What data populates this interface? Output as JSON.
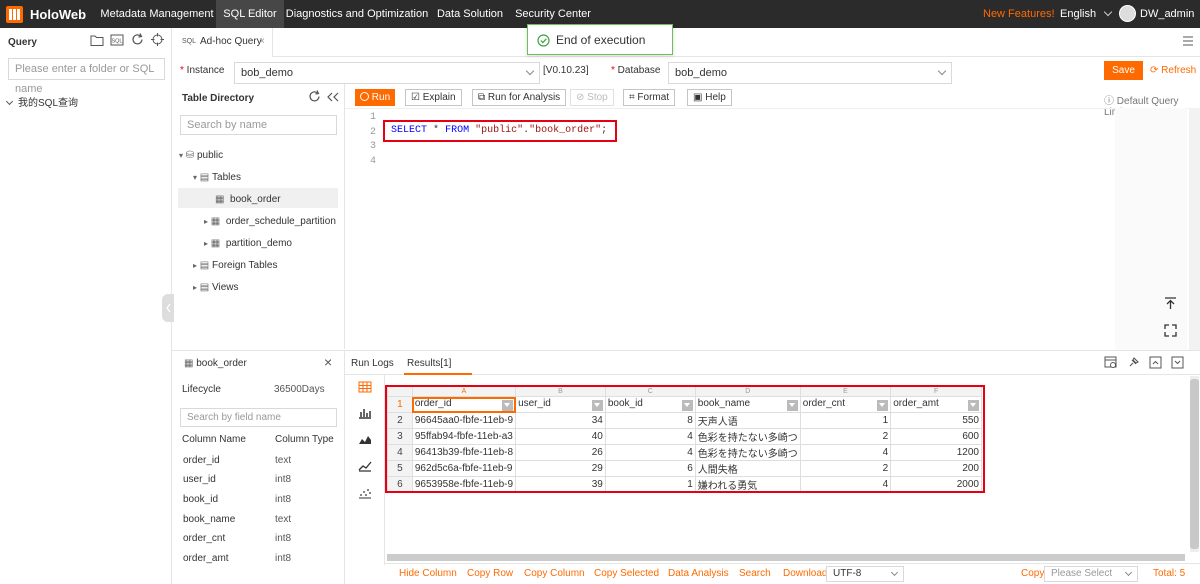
{
  "nav": {
    "brand": "HoloWeb",
    "items": [
      {
        "label": "Metadata Management",
        "active": false
      },
      {
        "label": "SQL Editor",
        "active": true
      },
      {
        "label": "Diagnostics and Optimization",
        "active": false
      },
      {
        "label": "Data Solution",
        "active": false
      },
      {
        "label": "Security Center",
        "active": false
      }
    ],
    "new_features": "New Features!",
    "language": "English",
    "username": "DW_admin"
  },
  "left_panel": {
    "title": "Query",
    "search_placeholder": "Please enter a folder or SQL name",
    "folder_label": "我的SQL查询"
  },
  "toast": {
    "message": "End of execution"
  },
  "tab": {
    "icon_text": "SQL",
    "label": "Ad-hoc Query"
  },
  "instance_bar": {
    "instance_label": "Instance",
    "instance_value": "bob_demo",
    "version": "[V0.10.23]",
    "database_label": "Database",
    "database_value": "bob_demo",
    "save_label": "Save",
    "refresh_label": "Refresh"
  },
  "table_directory": {
    "title": "Table Directory",
    "search_placeholder": "Search by name",
    "schema": "public",
    "tables_label": "Tables",
    "tables": [
      "book_order",
      "order_schedule_partition",
      "partition_demo"
    ],
    "foreign_tables_label": "Foreign Tables",
    "views_label": "Views"
  },
  "toolbar": {
    "run": "Run",
    "explain": "Explain",
    "run_for_analysis": "Run for Analysis",
    "stop": "Stop",
    "format": "Format",
    "help": "Help",
    "default_query_limit": "Default Query Limit"
  },
  "editor": {
    "line_numbers": [
      "1",
      "2",
      "3",
      "4"
    ],
    "sql_tokens": [
      {
        "text": "SELECT",
        "kind": "kw"
      },
      {
        "text": "*",
        "kind": "op"
      },
      {
        "text": "FROM",
        "kind": "kw"
      },
      {
        "text": "\"public\"",
        "kind": "str"
      },
      {
        "text": ".",
        "kind": "plain"
      },
      {
        "text": "\"book_order\"",
        "kind": "str"
      },
      {
        "text": ";",
        "kind": "plain"
      }
    ],
    "colors": {
      "kw": "#0000ff",
      "str": "#a31515",
      "plain": "#333333",
      "op": "#333333"
    }
  },
  "table_info": {
    "table_name": "book_order",
    "lifecycle_label": "Lifecycle",
    "lifecycle_value": "36500Days",
    "field_search_placeholder": "Search by field name",
    "column_name_header": "Column Name",
    "column_type_header": "Column Type",
    "columns": [
      {
        "name": "order_id",
        "type": "text"
      },
      {
        "name": "user_id",
        "type": "int8"
      },
      {
        "name": "book_id",
        "type": "int8"
      },
      {
        "name": "book_name",
        "type": "text"
      },
      {
        "name": "order_cnt",
        "type": "int8"
      },
      {
        "name": "order_amt",
        "type": "int8"
      }
    ]
  },
  "results": {
    "tab_run_logs": "Run Logs",
    "tab_results": "Results[1]",
    "col_letters": [
      "A",
      "B",
      "C",
      "D",
      "E",
      "F"
    ],
    "headers": [
      "order_id",
      "user_id",
      "book_id",
      "book_name",
      "order_cnt",
      "order_amt"
    ],
    "row_numbers": [
      "1",
      "2",
      "3",
      "4",
      "5",
      "6"
    ],
    "rows": [
      [
        "96645aa0-fbfe-11eb-9",
        "34",
        "8",
        "天声人语",
        "1",
        "550"
      ],
      [
        "95ffab94-fbfe-11eb-a3",
        "40",
        "4",
        "色彩を持たない多崎つ",
        "2",
        "600"
      ],
      [
        "96413b39-fbfe-11eb-8",
        "26",
        "4",
        "色彩を持たない多崎つ",
        "4",
        "1200"
      ],
      [
        "962d5c6a-fbfe-11eb-9",
        "29",
        "6",
        "人間失格",
        "2",
        "200"
      ],
      [
        "9653958e-fbfe-11eb-9",
        "39",
        "1",
        "嫌われる勇気",
        "4",
        "2000"
      ]
    ]
  },
  "bottom_bar": {
    "hide_column": "Hide Column",
    "copy_row": "Copy Row",
    "copy_column": "Copy Column",
    "copy_selected": "Copy Selected",
    "data_analysis": "Data Analysis",
    "search": "Search",
    "download": "Download",
    "encoding": "UTF-8",
    "copy_label": "Copy",
    "copy_select_placeholder": "Please Select",
    "total": "Total: 5"
  },
  "accent": "#ff6a00",
  "highlight": "#e60012"
}
